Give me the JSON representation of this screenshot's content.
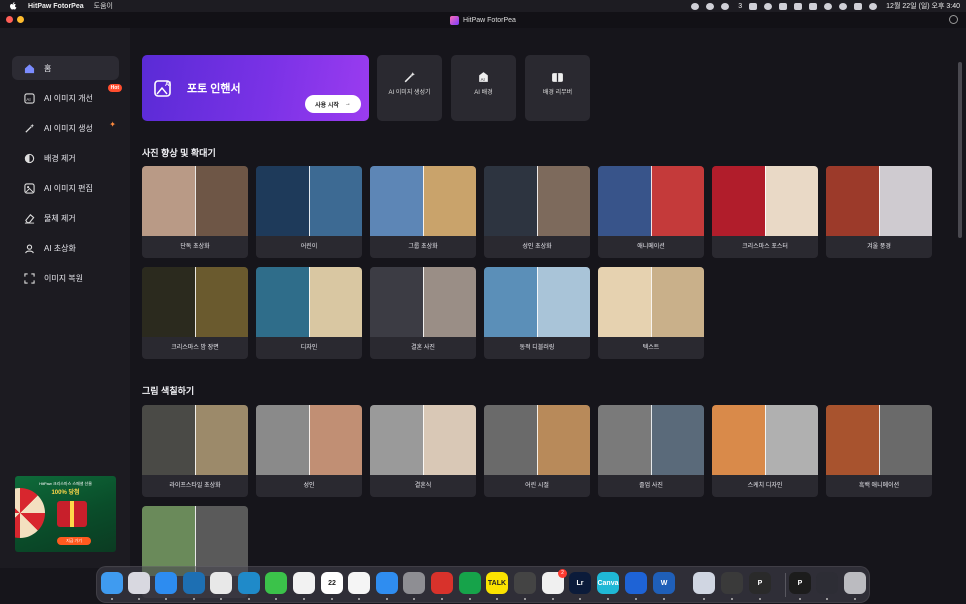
{
  "menubar": {
    "app_name": "HitPaw FotorPea",
    "menus": [
      "도움이"
    ],
    "status_icons": [
      "cloud-icon",
      "chat-icon",
      "task-icon",
      "clipboard-icon",
      "cc-icon",
      "zoom-icon",
      "keyboard-icon",
      "pen-icon",
      "wifi-icon",
      "search-icon",
      "control-center-icon",
      "siri-icon"
    ],
    "task_badge": "3",
    "clock": "12월 22일 (일) 오후 3:40"
  },
  "window": {
    "title": "HitPaw FotorPea"
  },
  "sidebar": {
    "items": [
      {
        "label": "홈",
        "icon": "home-icon",
        "active": true
      },
      {
        "label": "AI 이미지 개선",
        "icon": "ai-enhance-icon",
        "badge": "Hot"
      },
      {
        "label": "AI 이미지 생성",
        "icon": "magic-wand-icon"
      },
      {
        "label": "배경 제거",
        "icon": "toggle-circle-icon"
      },
      {
        "label": "AI 이미지 편집",
        "icon": "image-edit-icon"
      },
      {
        "label": "물체 제거",
        "icon": "eraser-icon"
      },
      {
        "label": "AI 초상화",
        "icon": "portrait-icon"
      },
      {
        "label": "이미지 복원",
        "icon": "restore-frame-icon"
      }
    ],
    "promo": {
      "line1": "HitPaw 크리스마스 스페셜 선물",
      "line2": "100% 당첨",
      "button": "지금 가기"
    }
  },
  "hero": {
    "title": "포토 인핸서",
    "button": "사용 시작"
  },
  "quick_tools": [
    {
      "label": "AI 이미지 생성기",
      "icon": "magic-wand-icon"
    },
    {
      "label": "AI 배경",
      "icon": "ai-background-icon"
    },
    {
      "label": "배경 리무버",
      "icon": "background-remover-icon"
    }
  ],
  "sections": [
    {
      "title": "사진 향상 및 확대기",
      "cards": [
        {
          "label": "단독 초상화",
          "colors": [
            "#b99a86",
            "#6e5646"
          ]
        },
        {
          "label": "어린이",
          "colors": [
            "#1e3a5a",
            "#3d6a93"
          ]
        },
        {
          "label": "그룹 초상화",
          "colors": [
            "#5d86b6",
            "#c9a36b"
          ]
        },
        {
          "label": "성인 초상화",
          "colors": [
            "#2d3440",
            "#7d6a5c"
          ]
        },
        {
          "label": "애니메이션",
          "colors": [
            "#38548a",
            "#c43a3a"
          ]
        },
        {
          "label": "크리스마스 포스터",
          "colors": [
            "#b11d2b",
            "#e9d9c6"
          ]
        },
        {
          "label": "겨울 풍경",
          "colors": [
            "#9c3a2a",
            "#cfcbd0"
          ]
        },
        {
          "label": "크리스마스 밤 장면",
          "colors": [
            "#2b2a1e",
            "#6a5a2e"
          ]
        },
        {
          "label": "디자인",
          "colors": [
            "#2f6d8a",
            "#d9c7a2"
          ]
        },
        {
          "label": "결혼 사진",
          "colors": [
            "#3c3c44",
            "#9a8e86"
          ]
        },
        {
          "label": "동적 디블러링",
          "colors": [
            "#5b8fb8",
            "#a9c4d8"
          ]
        },
        {
          "label": "텍스트",
          "colors": [
            "#e6d2b0",
            "#c9b08a"
          ]
        }
      ]
    },
    {
      "title": "그림 색칠하기",
      "cards": [
        {
          "label": "라이프스타일 초상화",
          "colors": [
            "#4a4a46",
            "#9c8a6a"
          ]
        },
        {
          "label": "성인",
          "colors": [
            "#8a8a8a",
            "#c18f74"
          ]
        },
        {
          "label": "결혼식",
          "colors": [
            "#9a9a9a",
            "#d9c8b6"
          ]
        },
        {
          "label": "어린 시절",
          "colors": [
            "#6a6a6a",
            "#b88a5a"
          ]
        },
        {
          "label": "졸업 사진",
          "colors": [
            "#7a7a7a",
            "#5a6a7a"
          ]
        },
        {
          "label": "스케치 디자인",
          "colors": [
            "#d98a4a",
            "#b0b0b0"
          ]
        },
        {
          "label": "흑백 애니메이션",
          "colors": [
            "#a8532e",
            "#6a6a6a"
          ]
        },
        {
          "label": "",
          "colors": [
            "#6a8a5a",
            "#5a5a5a"
          ]
        }
      ]
    }
  ],
  "dock": {
    "apps": [
      {
        "name": "finder-icon",
        "color": "#3f9bf0",
        "text": ""
      },
      {
        "name": "launchpad-icon",
        "color": "#d8d8e0",
        "text": ""
      },
      {
        "name": "safari-icon",
        "color": "#2d8cf0",
        "text": ""
      },
      {
        "name": "bluebird-icon",
        "color": "#1d6fb3",
        "text": ""
      },
      {
        "name": "chrome-icon",
        "color": "#e8e8e8",
        "text": ""
      },
      {
        "name": "edge-icon",
        "color": "#1f8ac9",
        "text": ""
      },
      {
        "name": "messages-icon",
        "color": "#3bc24a",
        "text": ""
      },
      {
        "name": "photos-icon",
        "color": "#f2f2f2",
        "text": ""
      },
      {
        "name": "calendar-icon",
        "color": "#ffffff",
        "text": "22"
      },
      {
        "name": "reminders-icon",
        "color": "#f5f5f5",
        "text": ""
      },
      {
        "name": "app-store-icon",
        "color": "#2f8df0",
        "text": ""
      },
      {
        "name": "system-settings-icon",
        "color": "#8e8e93",
        "text": ""
      },
      {
        "name": "remote-desktop-icon",
        "color": "#d8322b",
        "text": ""
      },
      {
        "name": "evernote-icon",
        "color": "#16a34a",
        "text": ""
      },
      {
        "name": "kakaotalk-icon",
        "color": "#fbe300",
        "text": "TALK"
      },
      {
        "name": "disk-icon",
        "color": "#444",
        "text": ""
      },
      {
        "name": "tasks-icon",
        "color": "#f0f0f0",
        "text": ""
      },
      {
        "name": "lightroom-icon",
        "color": "#0b1b3a",
        "text": "Lr"
      },
      {
        "name": "canva-icon",
        "color": "#1fb8d6",
        "text": "Canva"
      },
      {
        "name": "sidebar-app-icon",
        "color": "#1e63d6",
        "text": ""
      },
      {
        "name": "word-icon",
        "color": "#1f5fb8",
        "text": "W"
      },
      {
        "name": "preview-icon",
        "color": "#d0d6e2",
        "text": ""
      },
      {
        "name": "quicktime-icon",
        "color": "#3a3a3a",
        "text": ""
      },
      {
        "name": "fotorpea-icon",
        "color": "#2a2a2a",
        "text": "P"
      },
      {
        "name": "pea-app-icon",
        "color": "#1c1c1c",
        "text": "P"
      },
      {
        "name": "display-icon",
        "color": "#2d2d35",
        "text": ""
      },
      {
        "name": "trash-icon",
        "color": "#bbbbc0",
        "text": ""
      }
    ],
    "badge": "2"
  }
}
